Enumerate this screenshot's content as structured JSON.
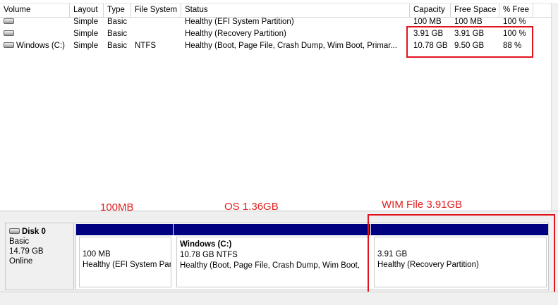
{
  "columns": [
    "Volume",
    "Layout",
    "Type",
    "File System",
    "Status",
    "Capacity",
    "Free Space",
    "% Free"
  ],
  "volumes": [
    {
      "name": "",
      "layout": "Simple",
      "type": "Basic",
      "fs": "",
      "status": "Healthy (EFI System Partition)",
      "capacity": "100 MB",
      "free": "100 MB",
      "pct": "100 %"
    },
    {
      "name": "",
      "layout": "Simple",
      "type": "Basic",
      "fs": "",
      "status": "Healthy (Recovery Partition)",
      "capacity": "3.91 GB",
      "free": "3.91 GB",
      "pct": "100 %"
    },
    {
      "name": "Windows (C:)",
      "layout": "Simple",
      "type": "Basic",
      "fs": "NTFS",
      "status": "Healthy (Boot, Page File, Crash Dump, Wim Boot, Primar...",
      "capacity": "10.78 GB",
      "free": "9.50 GB",
      "pct": "88 %"
    }
  ],
  "disk": {
    "name": "Disk 0",
    "type": "Basic",
    "size": "14.79 GB",
    "state": "Online"
  },
  "partitions": [
    {
      "name": "",
      "line1": "100 MB",
      "line2": "Healthy (EFI System Par"
    },
    {
      "name": "Windows  (C:)",
      "line1": "10.78 GB NTFS",
      "line2": "Healthy (Boot, Page File, Crash Dump, Wim Boot,"
    },
    {
      "name": "",
      "line1": "3.91 GB",
      "line2": "Healthy (Recovery Partition)"
    }
  ],
  "annotations": {
    "efi": "100MB",
    "os": "OS   1.36GB",
    "wim": "WIM File  3.91GB"
  },
  "colors": {
    "partition_bar": "#000080",
    "annotation_red": "#e02020"
  }
}
